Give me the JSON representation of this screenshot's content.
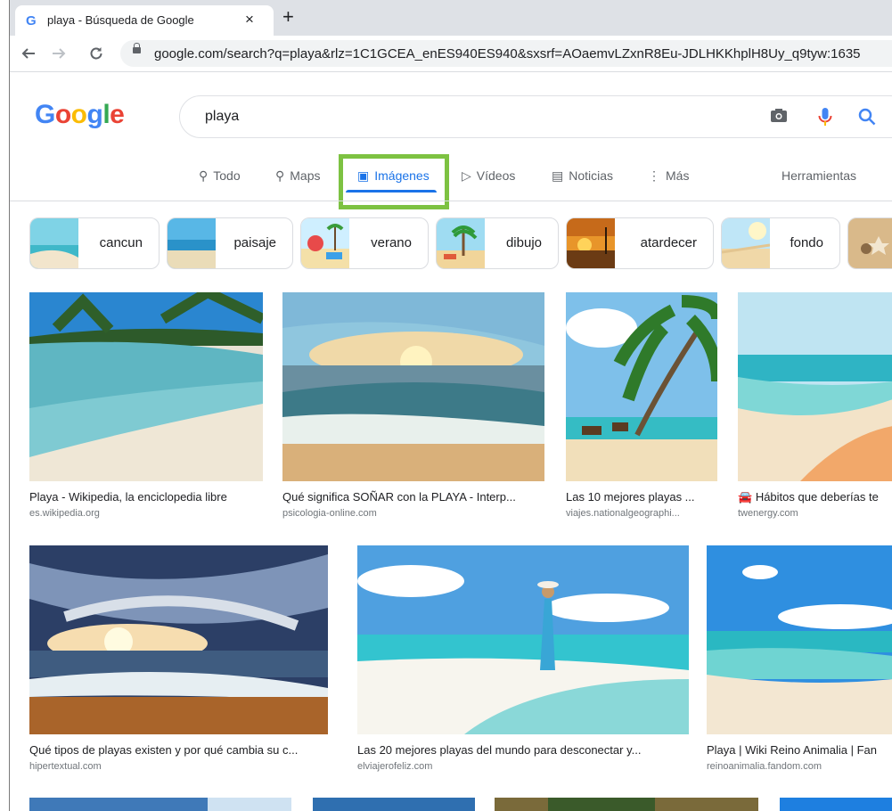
{
  "browser": {
    "tab_title": "playa - Búsqueda de Google",
    "tab_favicon": "G",
    "close_glyph": "×",
    "new_tab_glyph": "+",
    "url": "google.com/search?q=playa&rlz=1C1GCEA_enES940ES940&sxsrf=AOaemvLZxnR8Eu-JDLHKKhplH8Uy_q9tyw:1635"
  },
  "google": {
    "logo": [
      "G",
      "o",
      "o",
      "g",
      "l",
      "e"
    ],
    "logo_colors": [
      "#4285f4",
      "#ea4335",
      "#fbbc05",
      "#4285f4",
      "#34a853",
      "#ea4335"
    ],
    "query": "playa"
  },
  "menu": {
    "todo": "Todo",
    "maps": "Maps",
    "imagenes": "Imágenes",
    "videos": "Vídeos",
    "noticias": "Noticias",
    "mas": "Más",
    "herramientas": "Herramientas"
  },
  "chips": [
    "cancun",
    "paisaje",
    "verano",
    "dibujo",
    "atardecer",
    "fondo"
  ],
  "results": [
    {
      "caption": "Playa - Wikipedia, la enciclopedia libre",
      "source": "es.wikipedia.org"
    },
    {
      "caption": "Qué significa SOÑAR con la PLAYA - Interp...",
      "source": "psicologia-online.com"
    },
    {
      "caption": "Las 10 mejores playas ...",
      "source": "viajes.nationalgeographi..."
    },
    {
      "caption": "Hábitos que deberías te",
      "source": "twenergy.com"
    },
    {
      "caption": "Qué tipos de playas existen y por qué cambia su c...",
      "source": "hipertextual.com"
    },
    {
      "caption": "Las 20 mejores playas del mundo para desconectar y...",
      "source": "elviajerofeliz.com"
    },
    {
      "caption": "Playa | Wiki Reino Animalia | Fan",
      "source": "reinoanimalia.fandom.com"
    }
  ],
  "colors": {
    "accent": "#1a73e8",
    "highlight": "#7dc242"
  }
}
